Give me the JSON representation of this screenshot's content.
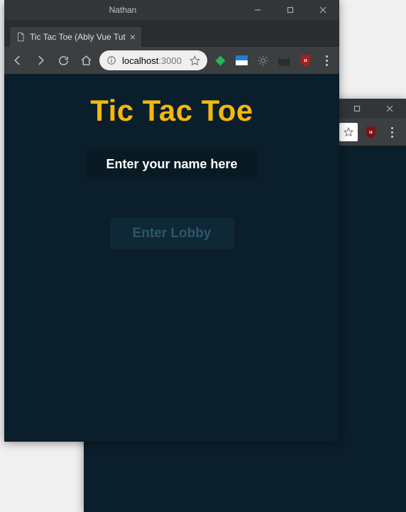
{
  "profile_name": "Nathan",
  "front_window": {
    "tab_title": "Tic Tac Toe (Ably Vue Tut",
    "url_host": "localhost",
    "url_port": ":3000",
    "page": {
      "heading": "Tic Tac Toe",
      "name_placeholder": "Enter your name here",
      "enter_lobby_label": "Enter Lobby"
    }
  }
}
